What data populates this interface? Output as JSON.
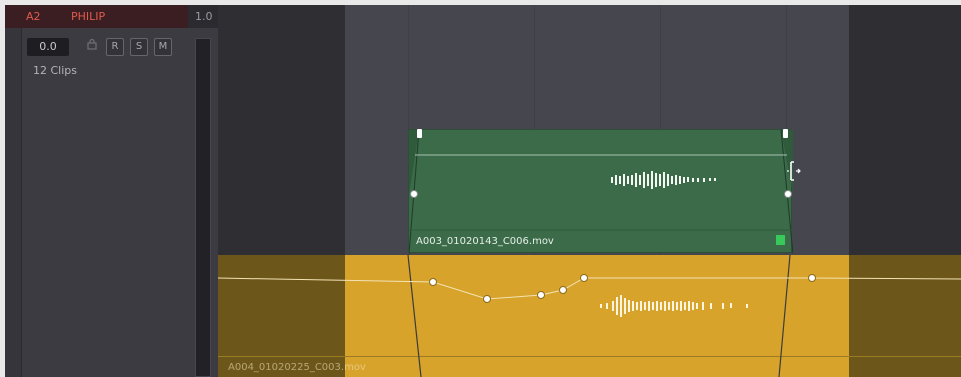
{
  "track": {
    "id": "A2",
    "name": "PHILIP",
    "number": "1.0",
    "volume": "0.0",
    "buttons": {
      "record": "R",
      "solo": "S",
      "mute": "M"
    },
    "clip_count": "12 Clips"
  },
  "clips": {
    "upper": {
      "name": "A003_01020143_C006.mov",
      "color": "#3b6b48",
      "marker_color": "#39c95a"
    },
    "lower": {
      "name": "A004_01020225_C003.mov",
      "color": "#d7a32a"
    }
  },
  "colors": {
    "track_label": "#e05a4e",
    "accent": "#d7a32a"
  }
}
